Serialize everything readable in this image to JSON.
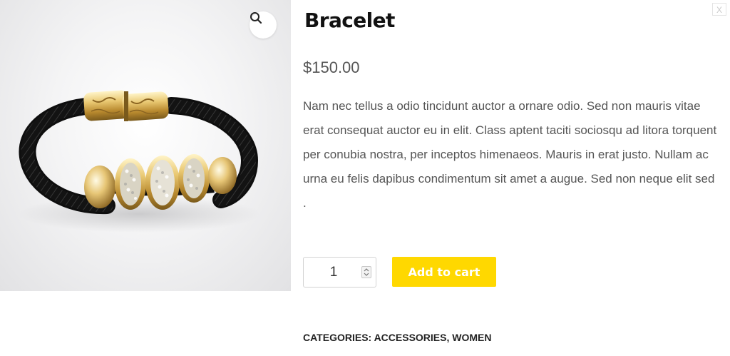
{
  "gallery": {
    "image_alt": "Bracelet",
    "zoom_icon": "magnifier-icon"
  },
  "product": {
    "title": "Bracelet",
    "price": "$150.00",
    "description": "Nam nec tellus a odio tincidunt auctor a ornare odio. Sed non mauris vitae erat consequat auctor eu in elit. Class aptent taciti sociosqu ad litora torquent per conubia nostra, per inceptos himenaeos. Mauris in erat justo. Nullam ac urna eu felis dapibus condimentum sit amet a augue. Sed non neque elit sed ."
  },
  "cart": {
    "quantity": "1",
    "add_label": "Add to cart",
    "button_color": "#ffd800"
  },
  "meta": {
    "categories_label": "Categories:",
    "categories": [
      "Accessories",
      "Women"
    ],
    "separator": ","
  },
  "close_label": "X"
}
